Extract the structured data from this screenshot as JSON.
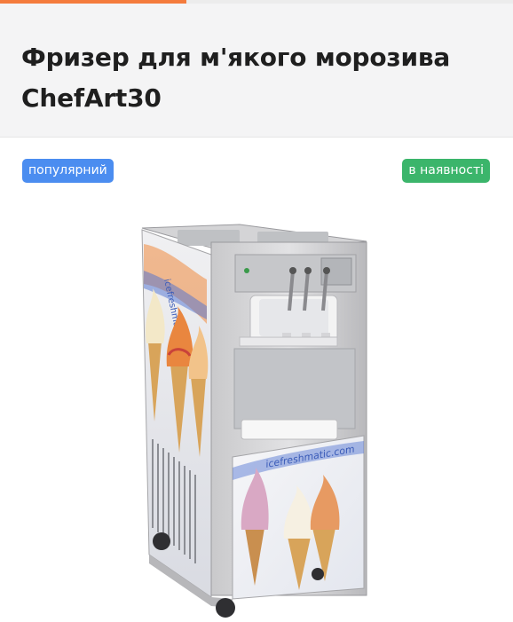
{
  "header": {
    "title": "Фризер для м'якого морозива ChefArt30"
  },
  "product": {
    "badges": {
      "popular": "популярний",
      "availability": "в наявності"
    },
    "image": {
      "brand_text_top": "icefreshmatic.com",
      "brand_text_bottom": "icefreshmatic.com"
    }
  },
  "colors": {
    "accent": "#f47b3c",
    "badge_popular": "#4b8df0",
    "badge_availability": "#3bb56b"
  }
}
